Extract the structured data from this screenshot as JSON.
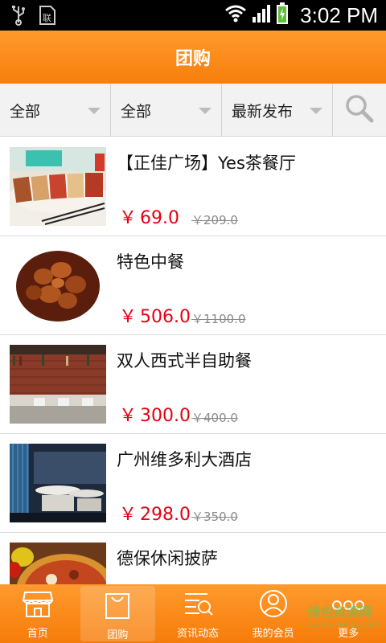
{
  "status_bar": {
    "time": "3:02 PM"
  },
  "header": {
    "title": "团购"
  },
  "filters": [
    {
      "label": "全部"
    },
    {
      "label": "全部"
    },
    {
      "label": "最新发布"
    }
  ],
  "deals": [
    {
      "name": "【正佳广场】Yes茶餐厅",
      "price": "69.0",
      "original": "￥209.0"
    },
    {
      "name": "特色中餐",
      "price": "506.0",
      "original": "￥1100.0"
    },
    {
      "name": "双人西式半自助餐",
      "price": "300.0",
      "original": "￥400.0"
    },
    {
      "name": "广州维多利大酒店",
      "price": "298.0",
      "original": "￥350.0"
    },
    {
      "name": "德保休闲披萨",
      "price": "",
      "original": ""
    }
  ],
  "currency_symbol": "￥",
  "tabs": [
    {
      "label": "首页",
      "icon": "shop-icon"
    },
    {
      "label": "团购",
      "icon": "bag-icon"
    },
    {
      "label": "资讯动态",
      "icon": "news-search-icon"
    },
    {
      "label": "我的会员",
      "icon": "user-icon"
    },
    {
      "label": "更多",
      "icon": "more-icon"
    }
  ],
  "watermark": {
    "text": "绿色资源网",
    "url": "www.downcc.com"
  },
  "colors": {
    "accent": "#f7860f",
    "price": "#e60012"
  }
}
